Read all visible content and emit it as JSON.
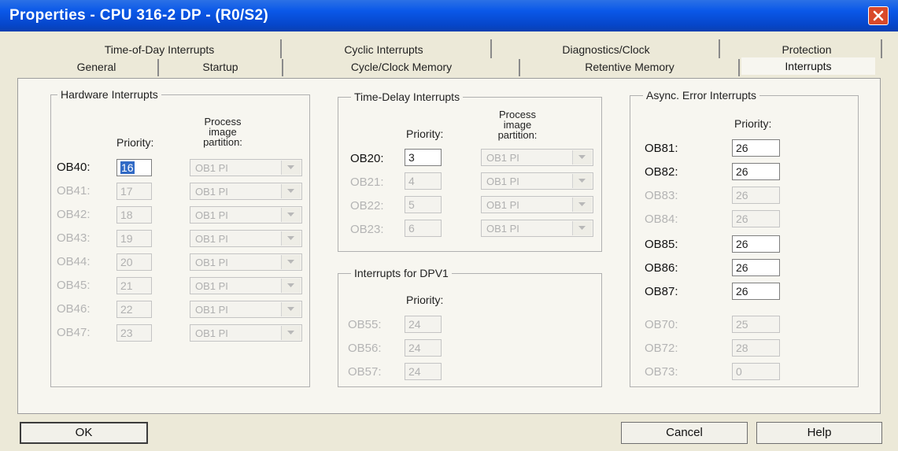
{
  "window": {
    "title": "Properties - CPU 316-2 DP - (R0/S2)"
  },
  "tabs_row1": [
    "Time-of-Day Interrupts",
    "Cyclic Interrupts",
    "Diagnostics/Clock",
    "Protection"
  ],
  "tabs_row2": [
    "General",
    "Startup",
    "Cycle/Clock Memory",
    "Retentive Memory",
    "Interrupts"
  ],
  "active_tab": "Interrupts",
  "hardware": {
    "title": "Hardware Interrupts",
    "priority_header": "Priority:",
    "partition_header": [
      "Process",
      "image",
      "partition:"
    ],
    "rows": [
      {
        "ob": "OB40:",
        "priority": "16",
        "pi": "OB1 PI"
      },
      {
        "ob": "OB41:",
        "priority": "17",
        "pi": "OB1 PI"
      },
      {
        "ob": "OB42:",
        "priority": "18",
        "pi": "OB1 PI"
      },
      {
        "ob": "OB43:",
        "priority": "19",
        "pi": "OB1 PI"
      },
      {
        "ob": "OB44:",
        "priority": "20",
        "pi": "OB1 PI"
      },
      {
        "ob": "OB45:",
        "priority": "21",
        "pi": "OB1 PI"
      },
      {
        "ob": "OB46:",
        "priority": "22",
        "pi": "OB1 PI"
      },
      {
        "ob": "OB47:",
        "priority": "23",
        "pi": "OB1 PI"
      }
    ]
  },
  "time_delay": {
    "title": "Time-Delay Interrupts",
    "priority_header": "Priority:",
    "partition_header": [
      "Process",
      "image",
      "partition:"
    ],
    "rows": [
      {
        "ob": "OB20:",
        "priority": "3",
        "pi": "OB1 PI"
      },
      {
        "ob": "OB21:",
        "priority": "4",
        "pi": "OB1 PI"
      },
      {
        "ob": "OB22:",
        "priority": "5",
        "pi": "OB1 PI"
      },
      {
        "ob": "OB23:",
        "priority": "6",
        "pi": "OB1 PI"
      }
    ]
  },
  "dpv1": {
    "title": "Interrupts for DPV1",
    "priority_header": "Priority:",
    "rows": [
      {
        "ob": "OB55:",
        "priority": "24"
      },
      {
        "ob": "OB56:",
        "priority": "24"
      },
      {
        "ob": "OB57:",
        "priority": "24"
      }
    ]
  },
  "async": {
    "title": "Async. Error Interrupts",
    "priority_header": "Priority:",
    "rows": [
      {
        "ob": "OB81:",
        "priority": "26"
      },
      {
        "ob": "OB82:",
        "priority": "26"
      },
      {
        "ob": "OB83:",
        "priority": "26"
      },
      {
        "ob": "OB84:",
        "priority": "26"
      },
      {
        "ob": "OB85:",
        "priority": "26"
      },
      {
        "ob": "OB86:",
        "priority": "26"
      },
      {
        "ob": "OB87:",
        "priority": "26"
      },
      {
        "ob": "OB70:",
        "priority": "25"
      },
      {
        "ob": "OB72:",
        "priority": "28"
      },
      {
        "ob": "OB73:",
        "priority": "0"
      }
    ]
  },
  "buttons": {
    "ok": "OK",
    "cancel": "Cancel",
    "help": "Help"
  },
  "colors": {
    "titlebar": "#0a58e8",
    "close": "#d9492a",
    "dialog": "#ece9d8",
    "selection": "#316ac5"
  }
}
